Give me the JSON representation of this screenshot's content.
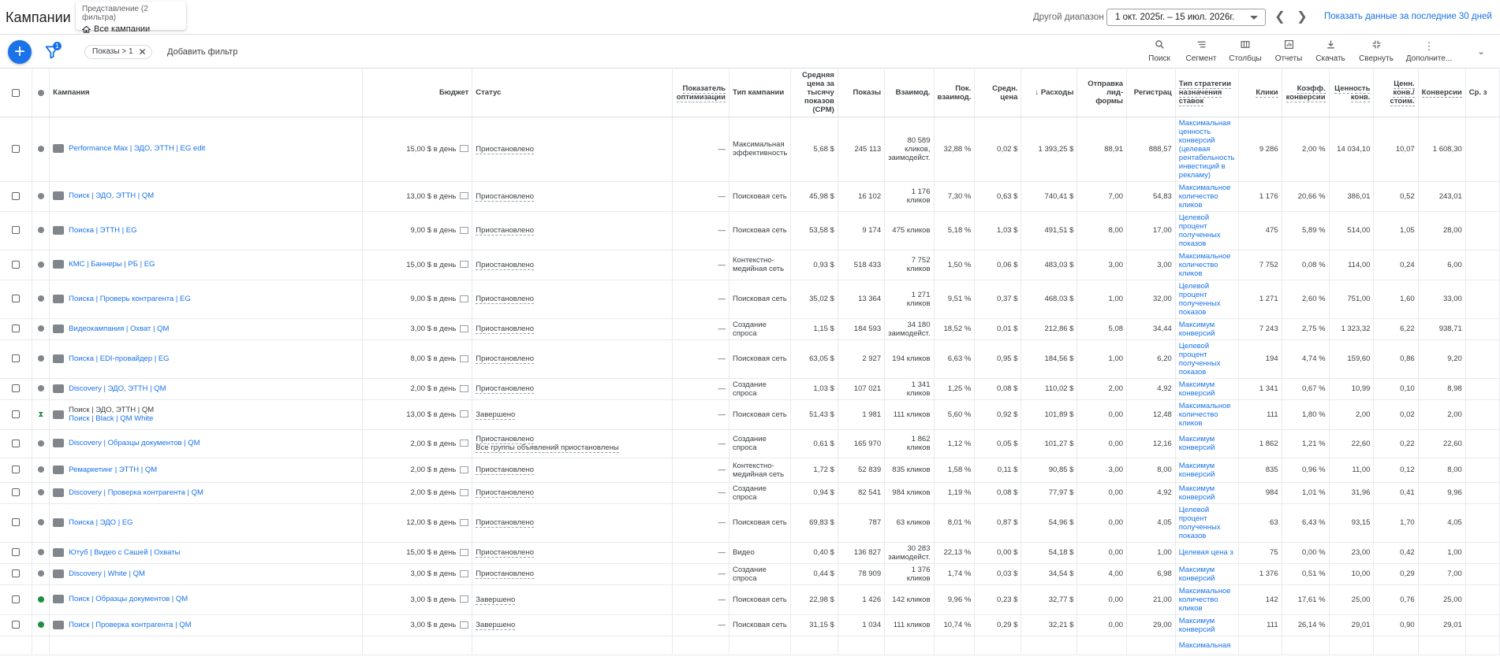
{
  "header": {
    "title": "Кампании",
    "view_label": "Представление (2 фильтра)",
    "view_value": "Все кампании",
    "range_label": "Другой диапазон",
    "date_range": "1 окт. 2025г. – 15 июл. 2026г.",
    "show_last_30": "Показать данные за последние 30 дней"
  },
  "toolbar": {
    "filter_count": "1",
    "filter_chip": "Показы > 1",
    "add_filter": "Добавить фильтр",
    "tools": [
      {
        "label": "Поиск",
        "icon": "search-icon"
      },
      {
        "label": "Сегмент",
        "icon": "segment-icon"
      },
      {
        "label": "Столбцы",
        "icon": "columns-icon"
      },
      {
        "label": "Отчеты",
        "icon": "reports-icon"
      },
      {
        "label": "Скачать",
        "icon": "download-icon"
      },
      {
        "label": "Свернуть",
        "icon": "collapse-icon"
      },
      {
        "label": "Дополните...",
        "icon": "more-icon"
      }
    ]
  },
  "columns": {
    "campaign": "Кампания",
    "budget": "Бюджет",
    "status": "Статус",
    "opt_score": "Показатель оптимизации",
    "type": "Тип кампании",
    "cpm": "Средняя цена за тысячу показов (CPM)",
    "impr": "Показы",
    "interactions": "Взаимод.",
    "int_rate": "Пок. взаимод.",
    "avg_cost": "Средн. цена",
    "cost": "Расходы",
    "leadform": "Отправка лид-формы",
    "registration": "Регистрац",
    "bid_strategy": "Тип стратегии назначения ставок",
    "clicks": "Клики",
    "conv_rate": "Коэфф. конверсии",
    "conv_value": "Ценность конв.",
    "conv_value_cost": "Ценн. конв./ стоим.",
    "conversions": "Конверсии",
    "cost_per_conv": "Ср. з"
  },
  "rows": [
    {
      "status_dot": "grey",
      "icon": "pmax-icon",
      "campaign": "Performance Max | ЭДО, ЭТТН | EG edit",
      "campaign2": "",
      "budget": "15,00 $ в день",
      "status": "Приостановлено",
      "status2": "",
      "opt": "—",
      "type": "Максимальная эффективность",
      "cpm": "5,68 $",
      "impr": "245 113",
      "inter": "80 589 кликов, заимодейст.",
      "rate": "32,88 %",
      "avg": "0,02 $",
      "cost": "1 393,25 $",
      "lead": "88,91",
      "reg": "888,57",
      "bid": "Максимальная ценность конверсий (целевая рентабельность инвестиций в рекламу)",
      "clicks": "9 286",
      "convr": "2,00 %",
      "cval": "14 034,10",
      "cvc": "10,07",
      "conv": "1 608,30"
    },
    {
      "status_dot": "grey",
      "icon": "search-campaign-icon",
      "campaign": "Поиск | ЭДО, ЭТТН | QM",
      "campaign2": "",
      "budget": "13,00 $ в день",
      "status": "Приостановлено",
      "status2": "",
      "opt": "—",
      "type": "Поисковая сеть",
      "cpm": "45,98 $",
      "impr": "16 102",
      "inter": "1 176 кликов",
      "rate": "7,30 %",
      "avg": "0,63 $",
      "cost": "740,41 $",
      "lead": "7,00",
      "reg": "54,83",
      "bid": "Максимальное количество кликов",
      "clicks": "1 176",
      "convr": "20,66 %",
      "cval": "386,01",
      "cvc": "0,52",
      "conv": "243,01"
    },
    {
      "status_dot": "grey",
      "icon": "search-campaign-icon",
      "campaign": "Поиска | ЭТТН | EG",
      "campaign2": "",
      "budget": "9,00 $ в день",
      "status": "Приостановлено",
      "status2": "",
      "opt": "—",
      "type": "Поисковая сеть",
      "cpm": "53,58 $",
      "impr": "9 174",
      "inter": "475 кликов",
      "rate": "5,18 %",
      "avg": "1,03 $",
      "cost": "491,51 $",
      "lead": "8,00",
      "reg": "17,00",
      "bid": "Целевой процент полученных показов",
      "clicks": "475",
      "convr": "5,89 %",
      "cval": "514,00",
      "cvc": "1,05",
      "conv": "28,00"
    },
    {
      "status_dot": "grey",
      "icon": "display-icon",
      "campaign": "КМС | Баннеры | РБ | EG",
      "campaign2": "",
      "budget": "15,00 $ в день",
      "status": "Приостановлено",
      "status2": "",
      "opt": "—",
      "type": "Контекстно-медийная сеть",
      "cpm": "0,93 $",
      "impr": "518 433",
      "inter": "7 752 кликов",
      "rate": "1,50 %",
      "avg": "0,06 $",
      "cost": "483,03 $",
      "lead": "3,00",
      "reg": "3,00",
      "bid": "Максимальное количество кликов",
      "clicks": "7 752",
      "convr": "0,08 %",
      "cval": "114,00",
      "cvc": "0,24",
      "conv": "6,00"
    },
    {
      "status_dot": "grey",
      "icon": "search-campaign-icon",
      "campaign": "Поиска | Проверь контрагента | EG",
      "campaign2": "",
      "budget": "9,00 $ в день",
      "status": "Приостановлено",
      "status2": "",
      "opt": "—",
      "type": "Поисковая сеть",
      "cpm": "35,02 $",
      "impr": "13 364",
      "inter": "1 271 кликов",
      "rate": "9,51 %",
      "avg": "0,37 $",
      "cost": "468,03 $",
      "lead": "1,00",
      "reg": "32,00",
      "bid": "Целевой процент полученных показов",
      "clicks": "1 271",
      "convr": "2,60 %",
      "cval": "751,00",
      "cvc": "1,60",
      "conv": "33,00"
    },
    {
      "status_dot": "grey",
      "icon": "demand-gen-icon",
      "campaign": "Видеокампания | Охват | QM",
      "campaign2": "",
      "budget": "3,00 $ в день",
      "status": "Приостановлено",
      "status2": "",
      "opt": "—",
      "type": "Создание спроса",
      "cpm": "1,15 $",
      "impr": "184 593",
      "inter": "34 180 заимодейст.",
      "rate": "18,52 %",
      "avg": "0,01 $",
      "cost": "212,86 $",
      "lead": "5,08",
      "reg": "34,44",
      "bid": "Максимум конверсий",
      "clicks": "7 243",
      "convr": "2,75 %",
      "cval": "1 323,32",
      "cvc": "6,22",
      "conv": "938,71"
    },
    {
      "status_dot": "grey",
      "icon": "search-campaign-icon",
      "campaign": "Поиска | EDI-провайдер | EG",
      "campaign2": "",
      "budget": "8,00 $ в день",
      "status": "Приостановлено",
      "status2": "",
      "opt": "—",
      "type": "Поисковая сеть",
      "cpm": "63,05 $",
      "impr": "2 927",
      "inter": "194 кликов",
      "rate": "6,63 %",
      "avg": "0,95 $",
      "cost": "184,56 $",
      "lead": "1,00",
      "reg": "6,20",
      "bid": "Целевой процент полученных показов",
      "clicks": "194",
      "convr": "4,74 %",
      "cval": "159,60",
      "cvc": "0,86",
      "conv": "9,20"
    },
    {
      "status_dot": "grey",
      "icon": "demand-gen-icon",
      "campaign": "Discovery | ЭДО, ЭТТН | QM",
      "campaign2": "",
      "budget": "2,00 $ в день",
      "status": "Приостановлено",
      "status2": "",
      "opt": "—",
      "type": "Создание спроса",
      "cpm": "1,03 $",
      "impr": "107 021",
      "inter": "1 341 кликов",
      "rate": "1,25 %",
      "avg": "0,08 $",
      "cost": "110,02 $",
      "lead": "2,00",
      "reg": "4,92",
      "bid": "Максимум конверсий",
      "clicks": "1 341",
      "convr": "0,67 %",
      "cval": "10,99",
      "cvc": "0,10",
      "conv": "8,98"
    },
    {
      "status_dot": "ended",
      "icon": "search-campaign-icon",
      "campaign": "Поиск | ЭДО, ЭТТН | QM",
      "campaign2": "Поиск | Black | QM White",
      "budget": "13,00 $ в день",
      "status": "Завершено",
      "status2": "",
      "opt": "—",
      "type": "Поисковая сеть",
      "cpm": "51,43 $",
      "impr": "1 981",
      "inter": "111 кликов",
      "rate": "5,60 %",
      "avg": "0,92 $",
      "cost": "101,89 $",
      "lead": "0,00",
      "reg": "12,48",
      "bid": "Максимальное количество кликов",
      "clicks": "111",
      "convr": "1,80 %",
      "cval": "2,00",
      "cvc": "0,02",
      "conv": "2,00"
    },
    {
      "status_dot": "grey",
      "icon": "demand-gen-icon",
      "campaign": "Discovery | Образцы документов | QM",
      "campaign2": "",
      "budget": "2,00 $ в день",
      "status": "Приостановлено",
      "status2": "Все группы объявлений приостановлены",
      "opt": "—",
      "type": "Создание спроса",
      "cpm": "0,61 $",
      "impr": "165 970",
      "inter": "1 862 кликов",
      "rate": "1,12 %",
      "avg": "0,05 $",
      "cost": "101,27 $",
      "lead": "0,00",
      "reg": "12,16",
      "bid": "Максимум конверсий",
      "clicks": "1 862",
      "convr": "1,21 %",
      "cval": "22,60",
      "cvc": "0,22",
      "conv": "22,60"
    },
    {
      "status_dot": "grey",
      "icon": "display-icon",
      "campaign": "Ремаркетинг | ЭТТН | QM",
      "campaign2": "",
      "budget": "2,00 $ в день",
      "status": "Приостановлено",
      "status2": "",
      "opt": "—",
      "type": "Контекстно-медийная сеть",
      "cpm": "1,72 $",
      "impr": "52 839",
      "inter": "835 кликов",
      "rate": "1,58 %",
      "avg": "0,11 $",
      "cost": "90,85 $",
      "lead": "3,00",
      "reg": "8,00",
      "bid": "Максимум конверсий",
      "clicks": "835",
      "convr": "0,96 %",
      "cval": "11,00",
      "cvc": "0,12",
      "conv": "8,00"
    },
    {
      "status_dot": "grey",
      "icon": "demand-gen-icon",
      "campaign": "Discovery | Проверка контрагента | QM",
      "campaign2": "",
      "budget": "2,00 $ в день",
      "status": "Приостановлено",
      "status2": "",
      "opt": "—",
      "type": "Создание спроса",
      "cpm": "0,94 $",
      "impr": "82 541",
      "inter": "984 кликов",
      "rate": "1,19 %",
      "avg": "0,08 $",
      "cost": "77,97 $",
      "lead": "0,00",
      "reg": "4,92",
      "bid": "Максимум конверсий",
      "clicks": "984",
      "convr": "1,01 %",
      "cval": "31,96",
      "cvc": "0,41",
      "conv": "9,96"
    },
    {
      "status_dot": "grey",
      "icon": "search-campaign-icon",
      "campaign": "Поиска | ЭДО | EG",
      "campaign2": "",
      "budget": "12,00 $ в день",
      "status": "Приостановлено",
      "status2": "",
      "opt": "—",
      "type": "Поисковая сеть",
      "cpm": "69,83 $",
      "impr": "787",
      "inter": "63 кликов",
      "rate": "8,01 %",
      "avg": "0,87 $",
      "cost": "54,96 $",
      "lead": "0,00",
      "reg": "4,05",
      "bid": "Целевой процент полученных показов",
      "clicks": "63",
      "convr": "6,43 %",
      "cval": "93,15",
      "cvc": "1,70",
      "conv": "4,05"
    },
    {
      "status_dot": "grey",
      "icon": "video-icon",
      "campaign": "Ютуб | Видео с Сашей | Охваты",
      "campaign2": "",
      "budget": "15,00 $ в день",
      "status": "Приостановлено",
      "status2": "",
      "opt": "—",
      "type": "Видео",
      "cpm": "0,40 $",
      "impr": "136 827",
      "inter": "30 283 заимодейст.",
      "rate": "22,13 %",
      "avg": "0,00 $",
      "cost": "54,18 $",
      "lead": "0,00",
      "reg": "1,00",
      "bid": "Целевая цена з",
      "clicks": "75",
      "convr": "0,00 %",
      "cval": "23,00",
      "cvc": "0,42",
      "conv": "1,00"
    },
    {
      "status_dot": "grey",
      "icon": "demand-gen-icon",
      "campaign": "Discovery | White | QM",
      "campaign2": "",
      "budget": "3,00 $ в день",
      "status": "Приостановлено",
      "status2": "",
      "opt": "—",
      "type": "Создание спроса",
      "cpm": "0,44 $",
      "impr": "78 909",
      "inter": "1 376 кликов",
      "rate": "1,74 %",
      "avg": "0,03 $",
      "cost": "34,54 $",
      "lead": "4,00",
      "reg": "6,98",
      "bid": "Максимум конверсий",
      "clicks": "1 376",
      "convr": "0,51 %",
      "cval": "10,00",
      "cvc": "0,29",
      "conv": "7,00"
    },
    {
      "status_dot": "green",
      "icon": "search-campaign-icon",
      "campaign": "Поиск | Образцы документов | QM",
      "campaign2": "",
      "budget": "3,00 $ в день",
      "status": "Завершено",
      "status2": "",
      "opt": "—",
      "type": "Поисковая сеть",
      "cpm": "22,98 $",
      "impr": "1 426",
      "inter": "142 кликов",
      "rate": "9,96 %",
      "avg": "0,23 $",
      "cost": "32,77 $",
      "lead": "0,00",
      "reg": "21,00",
      "bid": "Максимальное количество кликов",
      "clicks": "142",
      "convr": "17,61 %",
      "cval": "25,00",
      "cvc": "0,76",
      "conv": "25,00"
    },
    {
      "status_dot": "green",
      "icon": "search-campaign-icon",
      "campaign": "Поиск | Проверка контрагента | QM",
      "campaign2": "",
      "budget": "3,00 $ в день",
      "status": "Завершено",
      "status2": "",
      "opt": "—",
      "type": "Поисковая сеть",
      "cpm": "31,15 $",
      "impr": "1 034",
      "inter": "111 кликов",
      "rate": "10,74 %",
      "avg": "0,29 $",
      "cost": "32,21 $",
      "lead": "0,00",
      "reg": "29,00",
      "bid": "Максимум конверсий",
      "clicks": "111",
      "convr": "26,14 %",
      "cval": "29,01",
      "cvc": "0,90",
      "conv": "29,01"
    },
    {
      "status_dot": "",
      "icon": "",
      "campaign": "",
      "campaign2": "",
      "budget": "",
      "status": "",
      "status2": "",
      "opt": "",
      "type": "",
      "cpm": "",
      "impr": "",
      "inter": "",
      "rate": "",
      "avg": "",
      "cost": "",
      "lead": "",
      "reg": "",
      "bid": "Максимальная",
      "clicks": "",
      "convr": "",
      "cval": "",
      "cvc": "",
      "conv": ""
    }
  ],
  "colors": {
    "accent": "#1a73e8",
    "ended_green": "#1e8e3e",
    "paused_grey": "#80868b"
  }
}
